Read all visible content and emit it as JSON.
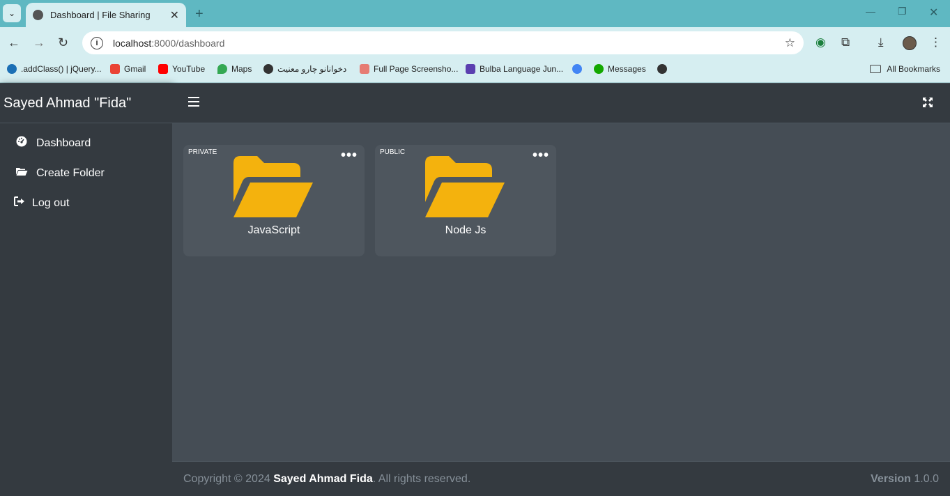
{
  "browser": {
    "tab_title": "Dashboard | File Sharing",
    "url_host": "localhost",
    "url_path": ":8000/dashboard",
    "bookmarks": [
      {
        "label": ".addClass() | jQuery...",
        "color": "#1b6fb5"
      },
      {
        "label": "Gmail",
        "color": "#ea4335"
      },
      {
        "label": "YouTube",
        "color": "#ff0000"
      },
      {
        "label": "Maps",
        "color": "#34a853"
      },
      {
        "label": "دخوانانو چارو معنيت",
        "color": "#333333"
      },
      {
        "label": "Full Page Screensho...",
        "color": "#e67c73"
      },
      {
        "label": "Bulba Language Jun...",
        "color": "#5b3fb0"
      },
      {
        "label": "",
        "color": "#4285f4"
      },
      {
        "label": "Messages",
        "color": "#14a800"
      },
      {
        "label": "",
        "color": "#333333"
      }
    ],
    "all_bookmarks": "All Bookmarks"
  },
  "sidebar": {
    "brand": "Sayed Ahmad \"Fida\"",
    "items": [
      {
        "label": "Dashboard",
        "icon": "tachometer-icon"
      },
      {
        "label": "Create Folder",
        "icon": "folder-open-icon"
      },
      {
        "label": "Log out",
        "icon": "sign-out-icon"
      }
    ]
  },
  "folders": [
    {
      "visibility": "PRIVATE",
      "name": "JavaScript"
    },
    {
      "visibility": "PUBLIC",
      "name": "Node Js"
    }
  ],
  "folder_color": "#f4b20d",
  "footer": {
    "copyright_prefix": "Copyright © 2024 ",
    "author": "Sayed Ahmad Fida",
    "suffix": ". All rights reserved.",
    "version_label": "Version",
    "version": "1.0.0"
  }
}
